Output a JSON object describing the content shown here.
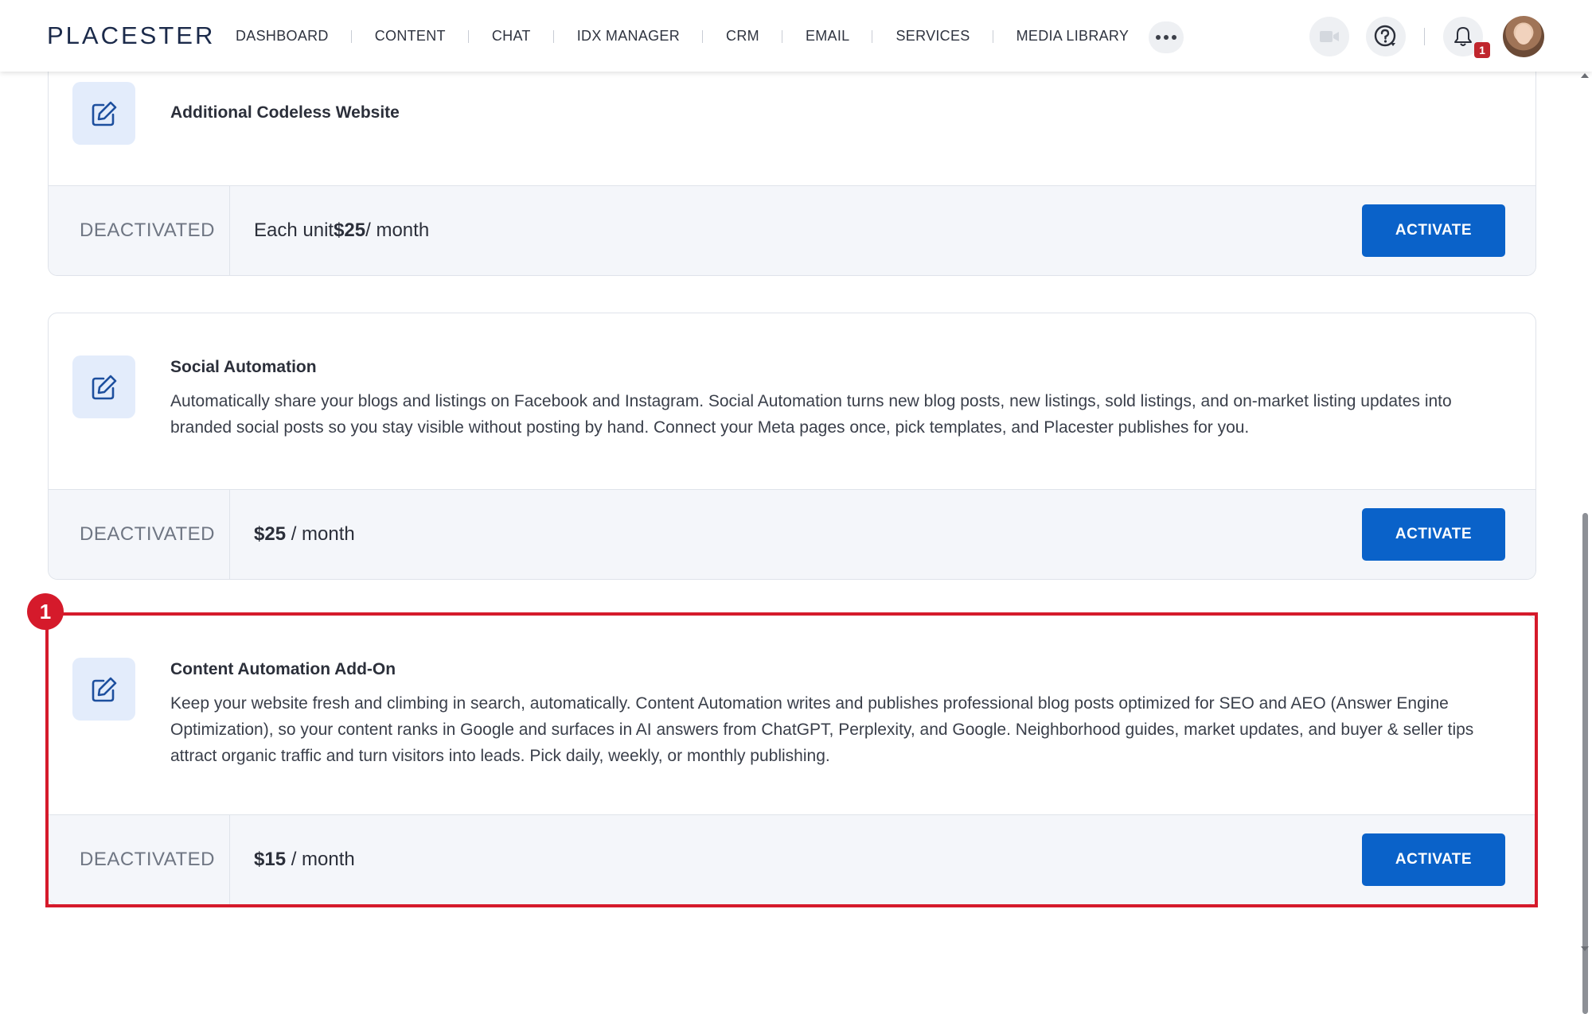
{
  "header": {
    "logo": "PLACESTER",
    "nav": [
      {
        "label": "DASHBOARD"
      },
      {
        "label": "CONTENT"
      },
      {
        "label": "CHAT"
      },
      {
        "label": "IDX MANAGER"
      },
      {
        "label": "CRM"
      },
      {
        "label": "EMAIL"
      },
      {
        "label": "SERVICES"
      },
      {
        "label": "MEDIA LIBRARY"
      }
    ],
    "notification_count": "1",
    "icons": [
      "more-icon",
      "video-camera-icon",
      "help-icon",
      "bell-icon",
      "avatar"
    ]
  },
  "cards": [
    {
      "title": "Additional Codeless Website",
      "status": "DEACTIVATED",
      "price_prefix": "Each unit ",
      "price": "$25",
      "price_suffix": " / month",
      "button": "ACTIVATE",
      "icon": "edit-icon"
    },
    {
      "title": "Social Automation",
      "description": "Automatically share your blogs and listings on Facebook and Instagram. Social Automation turns new blog posts, new listings, sold listings, and on-market listing updates into branded social posts so you stay visible without posting by hand. Connect your Meta pages once, pick templates, and Placester publishes for you.",
      "status": "DEACTIVATED",
      "price": "$25",
      "price_suffix": " / month",
      "button": "ACTIVATE",
      "icon": "edit-icon"
    },
    {
      "title": "Content Automation Add-On",
      "description": "Keep your website fresh and climbing in search, automatically. Content Automation writes and publishes professional blog posts optimized for SEO and AEO (Answer Engine Optimization), so your content ranks in Google and surfaces in AI answers from ChatGPT, Perplexity, and Google. Neighborhood guides, market updates, and buyer & seller tips attract organic traffic and turn visitors into leads. Pick daily, weekly, or monthly publishing.",
      "status": "DEACTIVATED",
      "price": "$15",
      "price_suffix": " / month",
      "button": "ACTIVATE",
      "icon": "edit-icon"
    }
  ],
  "annotation": {
    "marker": "1",
    "color": "#d51a2b"
  },
  "colors": {
    "primary_button": "#0a62c9",
    "icon_bg": "#e3ecfb",
    "footer_bg": "#f4f6fa",
    "badge": "#c0262d"
  }
}
